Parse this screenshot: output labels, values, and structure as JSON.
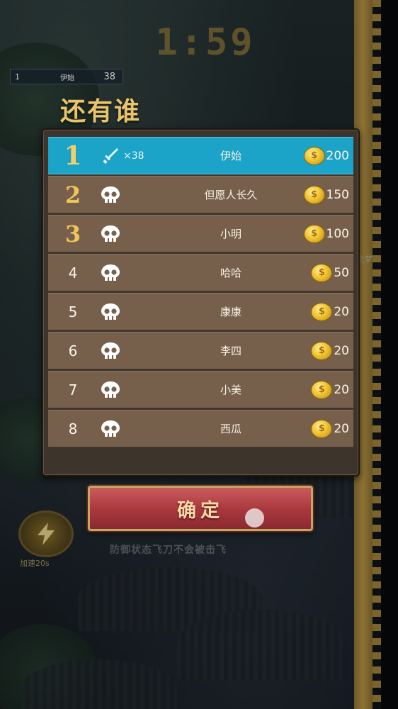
{
  "timer": "1:59",
  "hud": {
    "rank": "1",
    "name": "伊始",
    "value": "38"
  },
  "title": "还有谁",
  "side_text": "之梦",
  "leaderboard": [
    {
      "rank": "1",
      "icon": "sword-icon",
      "kills": "×38",
      "name": "伊始",
      "reward": "200",
      "highlight": true
    },
    {
      "rank": "2",
      "icon": "skull-icon",
      "kills": "",
      "name": "但愿人长久",
      "reward": "150"
    },
    {
      "rank": "3",
      "icon": "skull-icon",
      "kills": "",
      "name": "小明",
      "reward": "100"
    },
    {
      "rank": "4",
      "icon": "skull-icon",
      "kills": "",
      "name": "哈哈",
      "reward": "50"
    },
    {
      "rank": "5",
      "icon": "skull-icon",
      "kills": "",
      "name": "康康",
      "reward": "20"
    },
    {
      "rank": "6",
      "icon": "skull-icon",
      "kills": "",
      "name": "李四",
      "reward": "20"
    },
    {
      "rank": "7",
      "icon": "skull-icon",
      "kills": "",
      "name": "小美",
      "reward": "20"
    },
    {
      "rank": "8",
      "icon": "skull-icon",
      "kills": "",
      "name": "西瓜",
      "reward": "20"
    }
  ],
  "confirm_label": "确定",
  "speed_label": "加速20s",
  "hint_text": "防御状态飞刀不会被击飞",
  "colors": {
    "highlight_row": "#1ba3c8",
    "row": "#76604c",
    "title": "#e9c46a",
    "button": "#a8373d"
  }
}
